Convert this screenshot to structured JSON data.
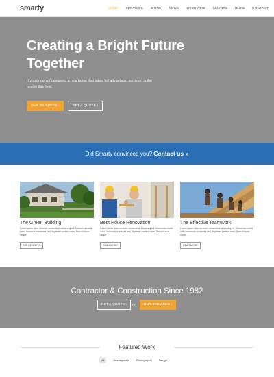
{
  "nav": {
    "logo": "smarty",
    "items": [
      {
        "label": "HOME",
        "active": true
      },
      {
        "label": "SERVICES",
        "active": false
      },
      {
        "label": "WORK",
        "active": false
      },
      {
        "label": "NEWS",
        "active": false
      },
      {
        "label": "OVERVIEW",
        "active": false
      },
      {
        "label": "CLIENTS",
        "active": false
      },
      {
        "label": "BLOG",
        "active": false
      },
      {
        "label": "CONTACT",
        "active": false
      }
    ]
  },
  "hero": {
    "title": "Creating a Bright Future Together",
    "subtitle": "If you dream of designing a new home that takes full advantage, our team is the best in this field.",
    "btn_services": "OUR SERVICES ›",
    "btn_quote": "GET A QUOTE ›"
  },
  "cta": {
    "text": "Did Smarty convinced you?",
    "link": "Contact us »"
  },
  "services": [
    {
      "title": "The Green Building",
      "text": "Lorem ipsum dolor sit amet, consectetur adipiscing elit. Maecenas mattis nulla, commodo a sodales sed, dignissim pretium nunc. Nam et lacus neque.",
      "button": "THE BENEFITS"
    },
    {
      "title": "Best House Renovation",
      "text": "Lorem ipsum dolor sit amet, consectetur adipiscing elit. Maecenas mattis nulla, commodo a sodales sed, dignissim pretium nunc. Nam et lacus neque.",
      "button": "READ MORE"
    },
    {
      "title": "The Effective Teamwork",
      "text": "Lorem ipsum dolor sit amet, consectetur adipiscing elit. Maecenas mattis nulla, commodo a sodales sed, dignissim pretium nunc. Nam et lacus neque.",
      "button": "READ MORE"
    }
  ],
  "contractor": {
    "title": "Contractor & Construction Since 1982",
    "btn_quote": "GET A QUOTE ›",
    "or": "OR",
    "btn_services": "OUR SERVICES ›"
  },
  "featured": {
    "title": "Featured Work",
    "filters": [
      {
        "label": "All",
        "active": true
      },
      {
        "label": "Development",
        "active": false
      },
      {
        "label": "Photography",
        "active": false
      },
      {
        "label": "Design",
        "active": false
      }
    ]
  },
  "colors": {
    "accent": "#f0a331",
    "blue": "#2a6fb5",
    "gray": "#8f8f8f"
  }
}
